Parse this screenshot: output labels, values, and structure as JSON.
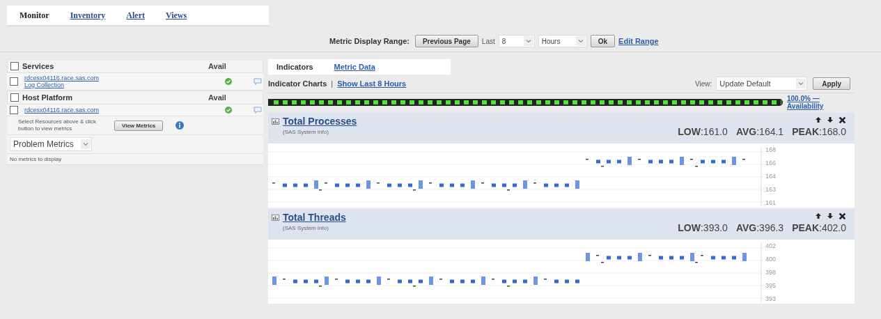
{
  "nav_tabs": [
    {
      "label": "Monitor",
      "selected": true
    },
    {
      "label": "Inventory",
      "selected": false
    },
    {
      "label": "Alert",
      "selected": false
    },
    {
      "label": "Views",
      "selected": false
    }
  ],
  "range_bar": {
    "label": "Metric Display Range:",
    "previous_button": "Previous Page",
    "last_label": "Last",
    "last_value": "8",
    "unit_value": "Hours",
    "ok_button": "Ok",
    "edit_link": "Edit Range"
  },
  "resources": {
    "groups": [
      {
        "title": "Services",
        "avail_header": "Avail",
        "checked": false,
        "items": [
          {
            "lines": [
              "rdcesx04116.race.sas.com",
              "Log Collection"
            ],
            "checked": false,
            "available": true
          }
        ]
      },
      {
        "title": "Host Platform",
        "avail_header": "Avail",
        "checked": false,
        "items": [
          {
            "lines": [
              "rdcesx04116.race.sas.com"
            ],
            "checked": false,
            "available": true
          }
        ]
      }
    ],
    "hint": "Select Resources above & click button to view metrics",
    "view_button": "View Metrics"
  },
  "problem_metrics": {
    "value": "Problem Metrics",
    "empty": "No metrics to display"
  },
  "detail_tabs": [
    {
      "label": "Indicators",
      "selected": true
    },
    {
      "label": "Metric Data",
      "selected": false
    }
  ],
  "toolbar": {
    "title": "Indicator Charts",
    "separator": "|",
    "link": "Show Last 8 Hours",
    "view_label": "View:",
    "view_value": "Update Default",
    "apply_button": "Apply"
  },
  "availability": {
    "percent": "100.0% —",
    "label": "Availability"
  },
  "charts": [
    {
      "title": "Total Processes",
      "source": "(SAS System Info)",
      "stats": [
        "**LOW**:161.0",
        "**AVG**:164.1",
        "**PEAK**:168.0"
      ],
      "y_ticks": [
        "168",
        "166",
        "164",
        "163",
        "161"
      ]
    },
    {
      "title": "Total Threads",
      "source": "(SAS System Info)",
      "stats": [
        "**LOW**:393.0",
        "**AVG**:396.3",
        "**PEAK**:402.0"
      ],
      "y_ticks": [
        "402",
        "400",
        "398",
        "395",
        "393"
      ]
    }
  ]
}
